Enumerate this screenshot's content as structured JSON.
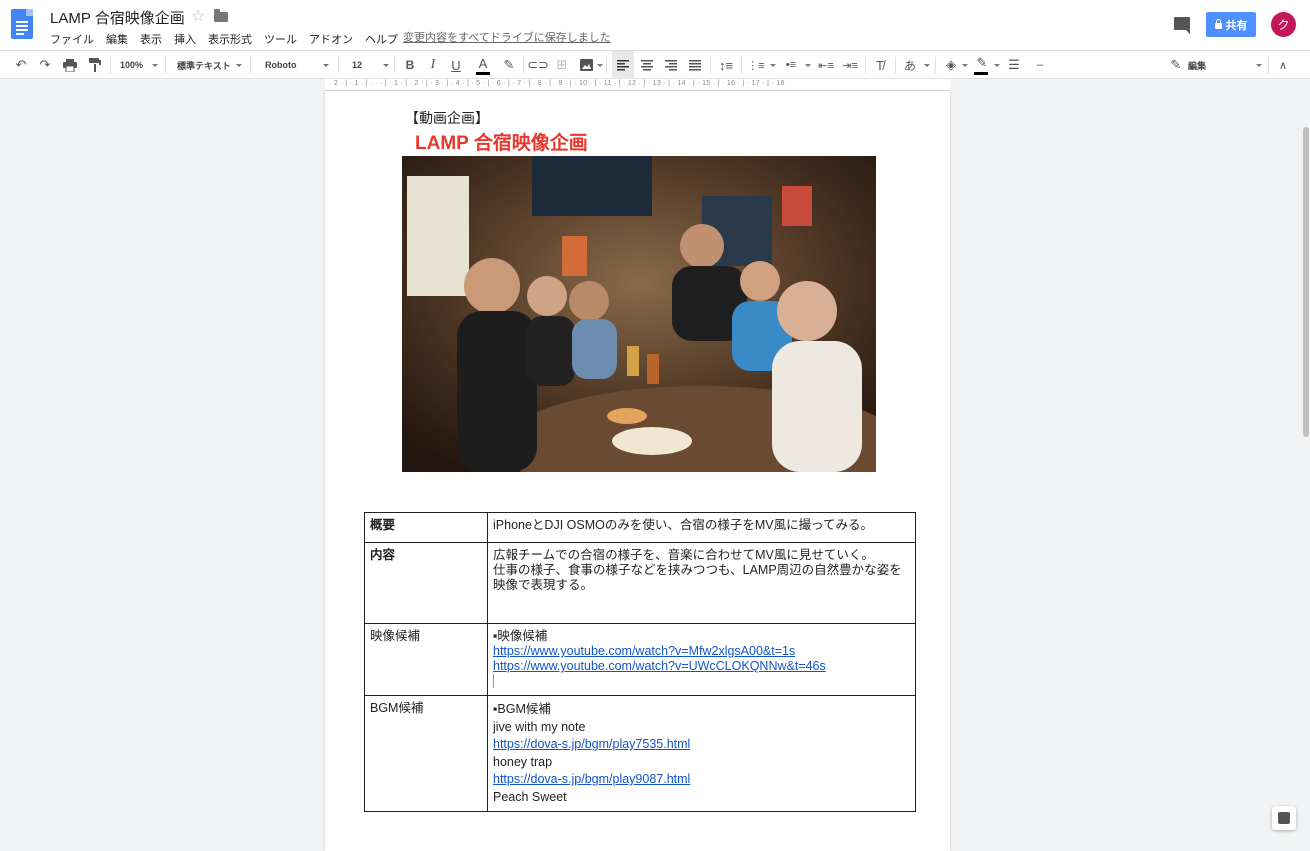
{
  "doc": {
    "title": "LAMP 合宿映像企画",
    "save_status": "変更内容をすべてドライブに保存しました",
    "share_label": "共有",
    "avatar_initial": "ク"
  },
  "menu": [
    "ファイル",
    "編集",
    "表示",
    "挿入",
    "表示形式",
    "ツール",
    "アドオン",
    "ヘルプ"
  ],
  "toolbar": {
    "zoom": "100%",
    "style": "標準テキスト",
    "font": "Roboto",
    "size": "12",
    "mode": "編集",
    "bold": "B",
    "italic": "I",
    "underline": "U",
    "text_color": "A",
    "input_tool": "あ"
  },
  "ruler": "· 2 · | · 1 · | · · · | · 1 · | · 2 · | · 3 · | · 4 · | · 5 · | · 6 · | · 7 · | · 8 · | · 9 · | · 10 · | · 11 · | · 12 · | · 13 · | · 14 · | · 15 · | · 16 · | · 17 · | · 18 ·",
  "page": {
    "heading_small": "【動画企画】",
    "heading_big": "LAMP 合宿映像企画",
    "table": {
      "row1": {
        "key": "概要",
        "value": "iPhoneとDJI OSMOのみを使い、合宿の様子をMV風に撮ってみる。"
      },
      "row2": {
        "key": "内容",
        "line1": "広報チームでの合宿の様子を、音楽に合わせてMV風に見せていく。",
        "line2": "仕事の様子、食事の様子などを挟みつつも、LAMP周辺の自然豊かな姿を映像で表現する。"
      },
      "row3": {
        "key": "映像候補",
        "bullet": "▪映像候補",
        "link1": "https://www.youtube.com/watch?v=Mfw2xlgsA00&t=1s",
        "link2": "https://www.youtube.com/watch?v=UWcCLOKQNNw&t=46s"
      },
      "row4": {
        "key": "BGM候補",
        "bullet": "▪BGM候補",
        "song1": "jive with my note",
        "link1": "https://dova-s.jp/bgm/play7535.html",
        "song2": "honey trap",
        "link2": "https://dova-s.jp/bgm/play9087.html",
        "song3": "Peach Sweet"
      }
    }
  },
  "colors": {
    "accent": "#4d90fe",
    "heading_red": "#e8372d",
    "link": "#1155cc",
    "avatar": "#c2185b"
  }
}
